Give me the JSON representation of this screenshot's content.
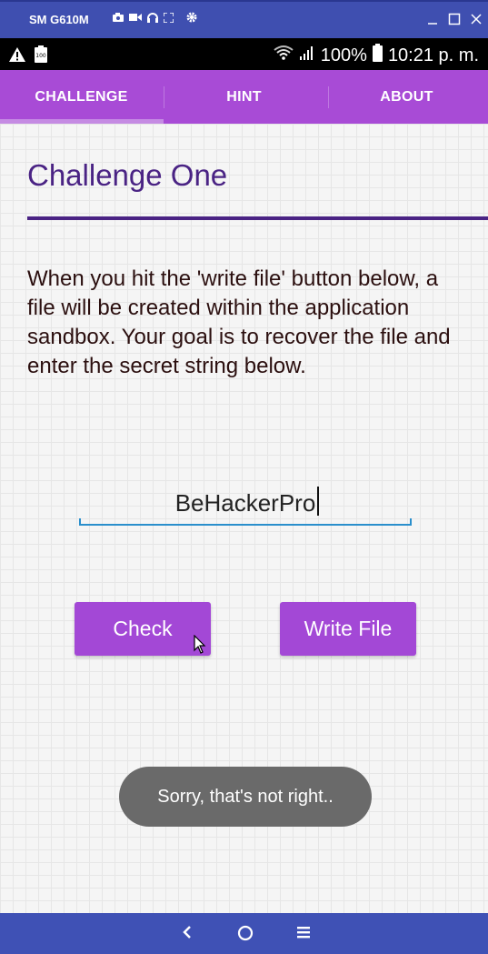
{
  "host": {
    "title": "SM G610M",
    "icons": [
      "camera-icon",
      "video-icon",
      "headset-icon",
      "fullscreen-icon",
      "settings-icon"
    ],
    "controls": [
      "minimize-icon",
      "maximize-icon",
      "close-icon"
    ]
  },
  "status_bar": {
    "left_icons": [
      "warning-icon",
      "battery-100-icon"
    ],
    "battery_percent": "100%",
    "time": "10:21 p. m."
  },
  "tabs": [
    {
      "label": "CHALLENGE",
      "selected": true
    },
    {
      "label": "HINT",
      "selected": false
    },
    {
      "label": "ABOUT",
      "selected": false
    }
  ],
  "challenge": {
    "title": "Challenge One",
    "description": "When you hit the 'write file' button below, a file will be created within the application sandbox. Your goal is to recover the file and enter the secret string below.",
    "secret_value": "BeHackerPro",
    "check_label": "Check",
    "write_label": "Write File"
  },
  "toast": "Sorry, that's not right..",
  "colors": {
    "accent": "#a84bd6",
    "title": "#4a2384",
    "input_underline": "#2a8fcc",
    "toast_bg": "#6a6a6a",
    "nav_bg": "#3f51b5"
  },
  "nav": [
    "back-icon",
    "home-icon",
    "recents-icon"
  ]
}
